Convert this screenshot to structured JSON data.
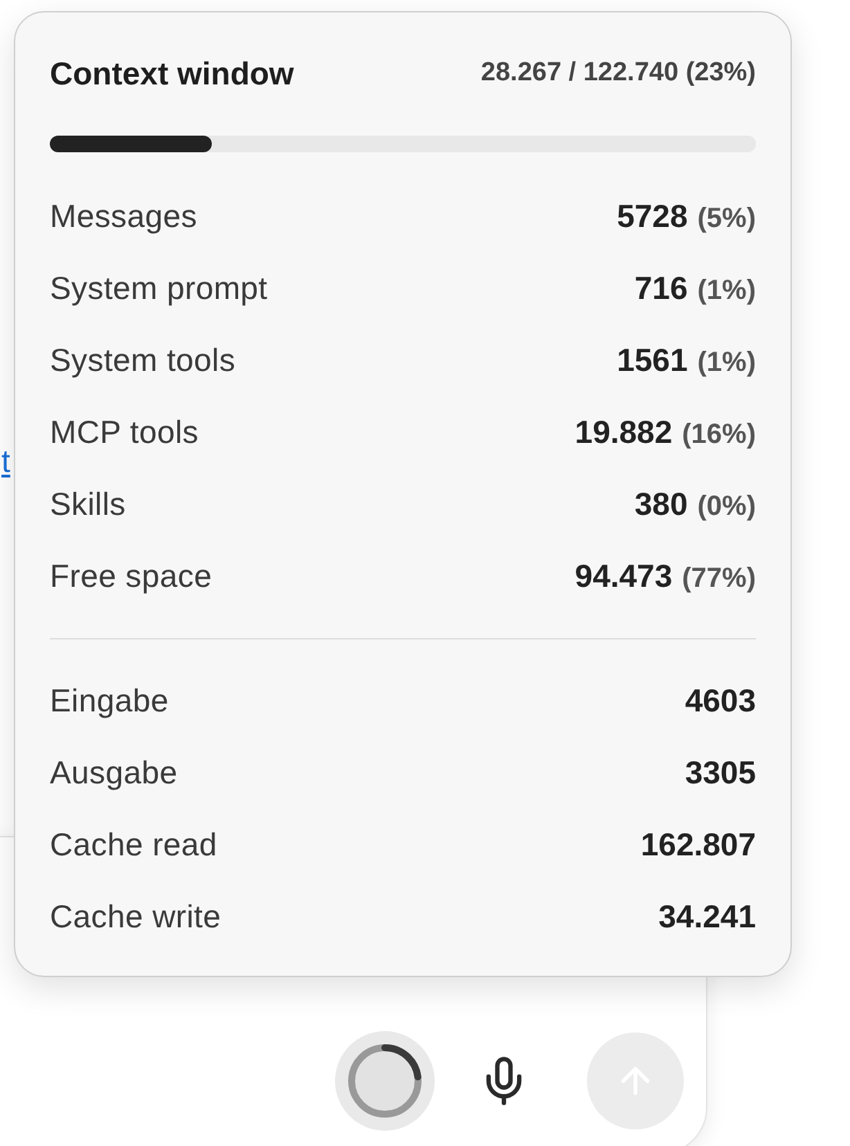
{
  "chat": {
    "link_text": "t"
  },
  "context_window": {
    "title": "Context window",
    "usage": "28.267 / 122.740 (23%)",
    "level": 0.23,
    "breakdown": [
      {
        "label": "Messages",
        "value": "5728",
        "percent": "(5%)"
      },
      {
        "label": "System prompt",
        "value": "716",
        "percent": "(1%)"
      },
      {
        "label": "System tools",
        "value": "1561",
        "percent": "(1%)"
      },
      {
        "label": "MCP tools",
        "value": "19.882",
        "percent": "(16%)"
      },
      {
        "label": "Skills",
        "value": "380",
        "percent": "(0%)"
      },
      {
        "label": "Free space",
        "value": "94.473",
        "percent": "(77%)"
      }
    ],
    "tokens": [
      {
        "label": "Eingabe",
        "value": "4603"
      },
      {
        "label": "Ausgabe",
        "value": "3305"
      },
      {
        "label": "Cache read",
        "value": "162.807"
      },
      {
        "label": "Cache write",
        "value": "34.241"
      }
    ]
  },
  "composer": {
    "send_button": {
      "disabled": true
    }
  }
}
